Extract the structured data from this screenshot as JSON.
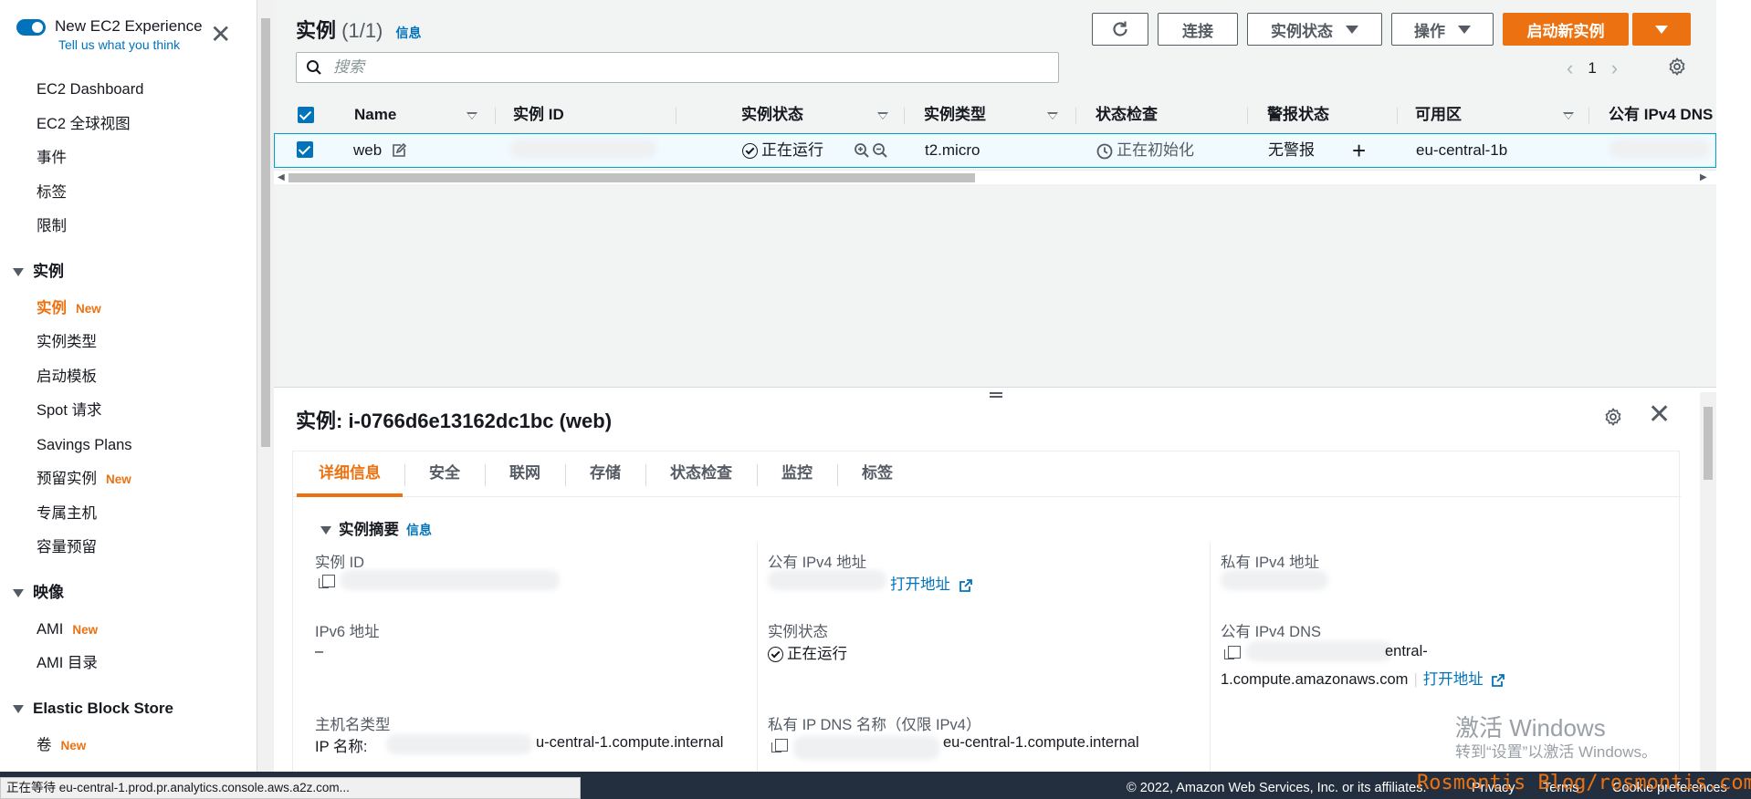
{
  "sidebar": {
    "toggle_title": "New EC2 Experience",
    "toggle_sub": "Tell us what you think",
    "items_top": [
      "EC2 Dashboard",
      "EC2 全球视图",
      "事件",
      "标签",
      "限制"
    ],
    "section_instances": "实例",
    "instances_items": [
      {
        "label": "实例",
        "badge": "New"
      },
      {
        "label": "实例类型",
        "badge": ""
      },
      {
        "label": "启动模板",
        "badge": ""
      },
      {
        "label": "Spot 请求",
        "badge": ""
      },
      {
        "label": "Savings Plans",
        "badge": ""
      },
      {
        "label": "预留实例",
        "badge": "New"
      },
      {
        "label": "专属主机",
        "badge": ""
      },
      {
        "label": "容量预留",
        "badge": ""
      }
    ],
    "section_images": "映像",
    "images_items": [
      {
        "label": "AMI",
        "badge": "New"
      },
      {
        "label": "AMI 目录",
        "badge": ""
      }
    ],
    "section_ebs": "Elastic Block Store",
    "ebs_items": [
      {
        "label": "卷",
        "badge": "New"
      }
    ]
  },
  "header": {
    "title": "实例",
    "count": "(1/1)",
    "info": "信息",
    "connect": "连接",
    "instance_state": "实例状态",
    "actions": "操作",
    "launch": "启动新实例",
    "search_placeholder": "搜索",
    "page": "1"
  },
  "table": {
    "columns": [
      "Name",
      "实例 ID",
      "实例状态",
      "实例类型",
      "状态检查",
      "警报状态",
      "可用区",
      "公有 IPv4 DNS"
    ],
    "row": {
      "name": "web",
      "state": "正在运行",
      "type": "t2.micro",
      "status_check": "正在初始化",
      "alarm": "无警报",
      "az": "eu-central-1b"
    }
  },
  "detail": {
    "title": "实例: i-0766d6e13162dc1bc (web)",
    "tabs": [
      "详细信息",
      "安全",
      "联网",
      "存储",
      "状态检查",
      "监控",
      "标签"
    ],
    "section": "实例摘要",
    "info": "信息",
    "fields": {
      "instance_id_label": "实例 ID",
      "public_ipv4_label": "公有 IPv4 地址",
      "open_address": "打开地址",
      "private_ipv4_label": "私有 IPv4 地址",
      "ipv6_label": "IPv6 地址",
      "ipv6_value": "–",
      "state_label": "实例状态",
      "state_value": "正在运行",
      "public_dns_label": "公有 IPv4 DNS",
      "public_dns_tail1": "entral-",
      "public_dns_tail2": "1.compute.amazonaws.com",
      "hostname_type_label": "主机名类型",
      "ip_name_label": "IP 名称:",
      "ip_name_tail": "u-central-1.compute.internal",
      "private_dns_label": "私有 IP DNS 名称（仅限 IPv4）",
      "private_dns_tail": "eu-central-1.compute.internal"
    }
  },
  "watermark": {
    "line1": "激活 Windows",
    "line2": "转到“设置”以激活 Windows。"
  },
  "footer": {
    "loading": "正在等待 eu-central-1.prod.pr.analytics.console.aws.a2z.com...",
    "copyright": "© 2022, Amazon Web Services, Inc. or its affiliates.",
    "privacy": "Privacy",
    "terms": "Terms",
    "cookie": "Cookie preferences",
    "blog": "Rosmontis Blog/rosmontis.com"
  },
  "colors": {
    "accent": "#ec7211",
    "link": "#0073bb",
    "footer_bg": "#232f3e"
  }
}
